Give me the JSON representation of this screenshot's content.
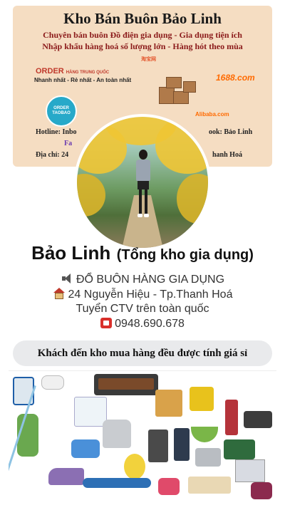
{
  "cover": {
    "title": "Kho Bán Buôn Bảo Linh",
    "line1": "Chuyên bán buôn Đồ điện gia dụng - Gia dụng tiện ích",
    "line2": "Nhập khẩu hàng hoá số lượng lớn - Hàng hót theo mùa",
    "order_title": "ORDER",
    "order_sub": "HÀNG TRUNG QUỐC",
    "order_tags": "Nhanh nhất - Rẻ nhất - An toàn nhất",
    "order_badge": "ORDER TAOBAO",
    "logo_taobao": "淘宝网",
    "logo_1688": "1688.com",
    "logo_alibaba": "Alibaba.com",
    "hotline": "Hotline: Inbo",
    "facebook": "ook: Bảo Linh",
    "fanpage": "Fa",
    "address": "Địa chỉ: 24",
    "city": "hanh Hoá"
  },
  "profile": {
    "name": "Bảo Linh",
    "subname": "(Tổng kho gia dụng)",
    "bio_line1": "ĐỔ BUÔN HÀNG GIA DỤNG",
    "bio_line2": "24 Nguyễn Hiệu - Tp.Thanh Hoá",
    "bio_line3": "Tuyển CTV trên toàn quốc",
    "phone": "0948.690.678"
  },
  "promo": {
    "text": "Khách đến kho mua hàng đều được tính giá sỉ"
  },
  "icons": {
    "bio1": "speaker-icon",
    "bio2": "house-icon",
    "phone": "telephone-icon"
  }
}
